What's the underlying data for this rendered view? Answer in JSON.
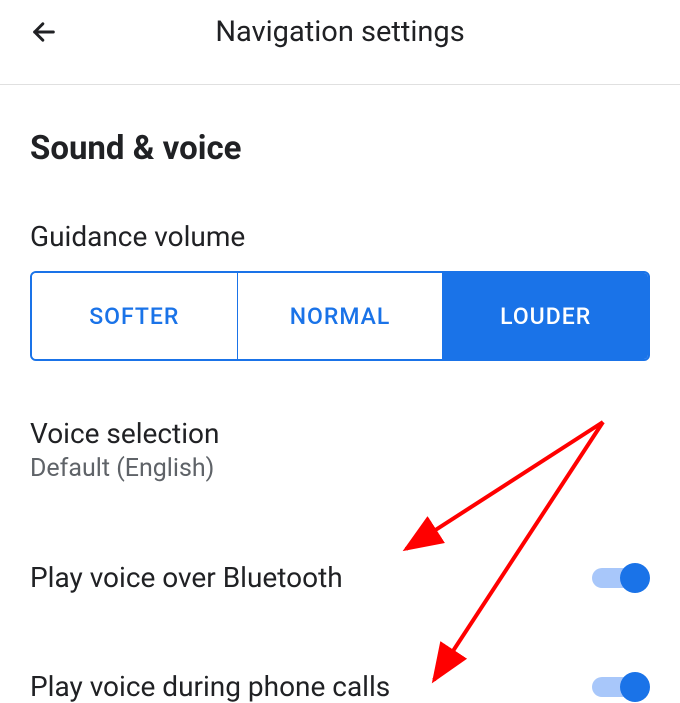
{
  "header": {
    "title": "Navigation settings"
  },
  "sound_voice": {
    "section_title": "Sound & voice",
    "guidance_volume": {
      "label": "Guidance volume",
      "options": [
        "SOFTER",
        "NORMAL",
        "LOUDER"
      ],
      "selected": "LOUDER"
    },
    "voice_selection": {
      "label": "Voice selection",
      "value": "Default (English)"
    },
    "play_over_bluetooth": {
      "label": "Play voice over Bluetooth",
      "enabled": true
    },
    "play_during_calls": {
      "label": "Play voice during phone calls",
      "enabled": true
    }
  }
}
